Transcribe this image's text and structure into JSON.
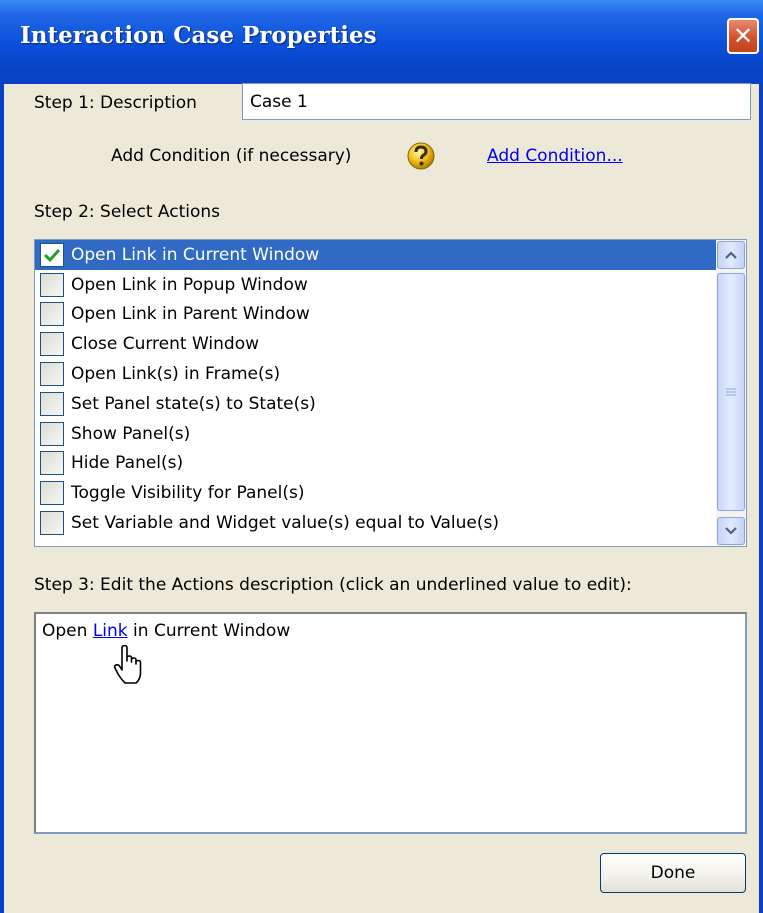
{
  "window": {
    "title": "Interaction Case Properties",
    "close_symbol": "✕"
  },
  "step1": {
    "label": "Step 1: Description",
    "description_value": "Case 1",
    "condition_label": "Add Condition (if necessary)",
    "help_icon": "question-icon",
    "add_condition_link": "Add Condition..."
  },
  "step2": {
    "label": "Step 2: Select Actions",
    "actions": [
      {
        "label": "Open Link in Current Window",
        "checked": true,
        "selected": true
      },
      {
        "label": "Open Link in Popup Window",
        "checked": false,
        "selected": false
      },
      {
        "label": "Open Link in Parent Window",
        "checked": false,
        "selected": false
      },
      {
        "label": "Close Current Window",
        "checked": false,
        "selected": false
      },
      {
        "label": "Open Link(s) in Frame(s)",
        "checked": false,
        "selected": false
      },
      {
        "label": "Set Panel state(s) to State(s)",
        "checked": false,
        "selected": false
      },
      {
        "label": "Show Panel(s)",
        "checked": false,
        "selected": false
      },
      {
        "label": "Hide Panel(s)",
        "checked": false,
        "selected": false
      },
      {
        "label": "Toggle Visibility for Panel(s)",
        "checked": false,
        "selected": false
      },
      {
        "label": "Set Variable and Widget value(s) equal to Value(s)",
        "checked": false,
        "selected": false
      }
    ]
  },
  "step3": {
    "label": "Step 3: Edit the Actions description (click an underlined value to edit):",
    "desc_prefix": "Open ",
    "desc_link": "Link",
    "desc_suffix": " in Current Window"
  },
  "buttons": {
    "done": "Done"
  },
  "colors": {
    "title_bar": "#0a4ed9",
    "selection": "#316ac5",
    "check": "#21a121",
    "link": "#0000ee",
    "window_bg": "#ece9d8"
  }
}
